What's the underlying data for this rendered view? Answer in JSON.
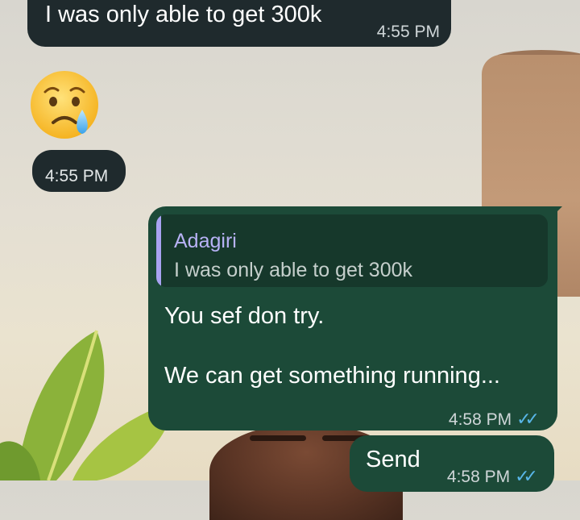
{
  "chat": {
    "messages": [
      {
        "direction": "incoming",
        "text": "I was only able to get 300k",
        "time": "4:55 PM"
      },
      {
        "direction": "incoming",
        "emoji": "😢",
        "time": "4:55 PM"
      },
      {
        "direction": "outgoing",
        "reply": {
          "author": "Adagiri",
          "text": "I was only able to get 300k"
        },
        "lines": [
          "You sef don try.",
          "We can get something running..."
        ],
        "time": "4:58 PM",
        "status": "read"
      },
      {
        "direction": "outgoing",
        "text": "Send",
        "time": "4:58 PM",
        "status": "read"
      }
    ]
  },
  "colors": {
    "incoming_bubble": "#1f2a2d",
    "outgoing_bubble": "#1c4a38",
    "reply_author": "#b8b2f6",
    "read_ticks": "#58b6e8"
  }
}
